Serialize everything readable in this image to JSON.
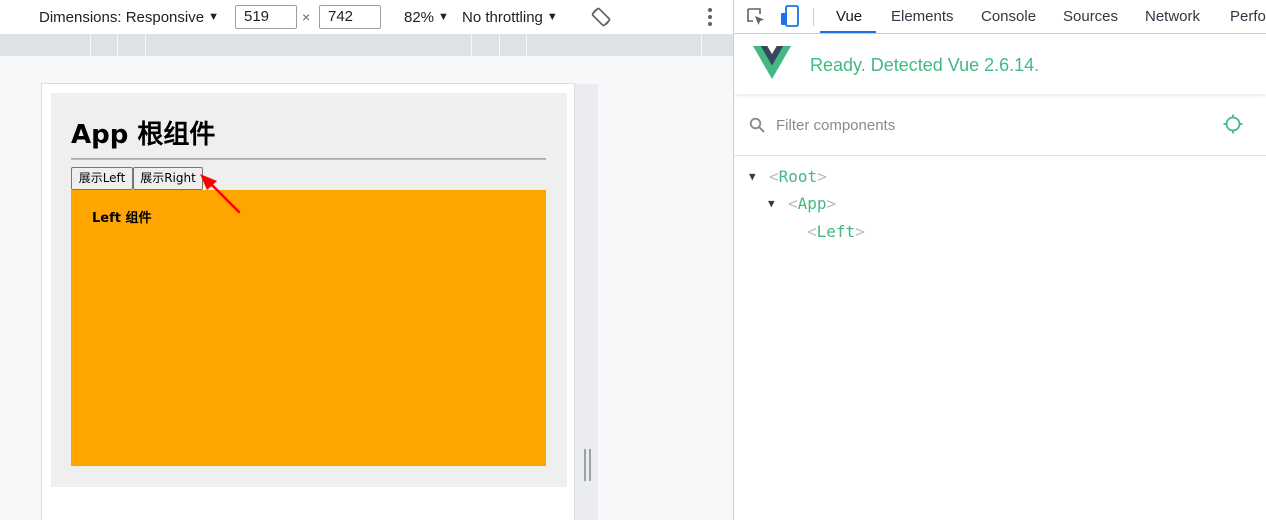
{
  "emulation_toolbar": {
    "dimensions_label": "Dimensions: Responsive",
    "width": "519",
    "times": "×",
    "height": "742",
    "zoom": "82%",
    "throttling": "No throttling"
  },
  "app": {
    "title": "App 根组件",
    "buttons": {
      "show_left": "展示Left",
      "show_right": "展示Right"
    },
    "left_component_title": "Left 组件"
  },
  "devtools": {
    "tabs": [
      "Vue",
      "Elements",
      "Console",
      "Sources",
      "Network",
      "Perfo"
    ],
    "active_tab": "Vue",
    "vue_status": "Ready. Detected Vue 2.6.14.",
    "filter_placeholder": "Filter components",
    "tree": [
      {
        "name": "Root",
        "expanded": true,
        "depth": 0
      },
      {
        "name": "App",
        "expanded": true,
        "depth": 1
      },
      {
        "name": "Left",
        "expanded": false,
        "depth": 2
      }
    ]
  },
  "colors": {
    "vue_green": "#42b983",
    "vue_dark": "#35495e",
    "left_component_bg": "#ffa500",
    "active_tab_underline": "#1a73e8",
    "annotation_arrow": "#ff0000"
  },
  "icons": [
    "dropdown-arrow-icon",
    "rotate-icon",
    "kebab-menu-icon",
    "inspect-element-icon",
    "device-toolbar-icon",
    "vue-logo-icon",
    "search-icon",
    "target-select-icon",
    "expand-caret-icon"
  ]
}
